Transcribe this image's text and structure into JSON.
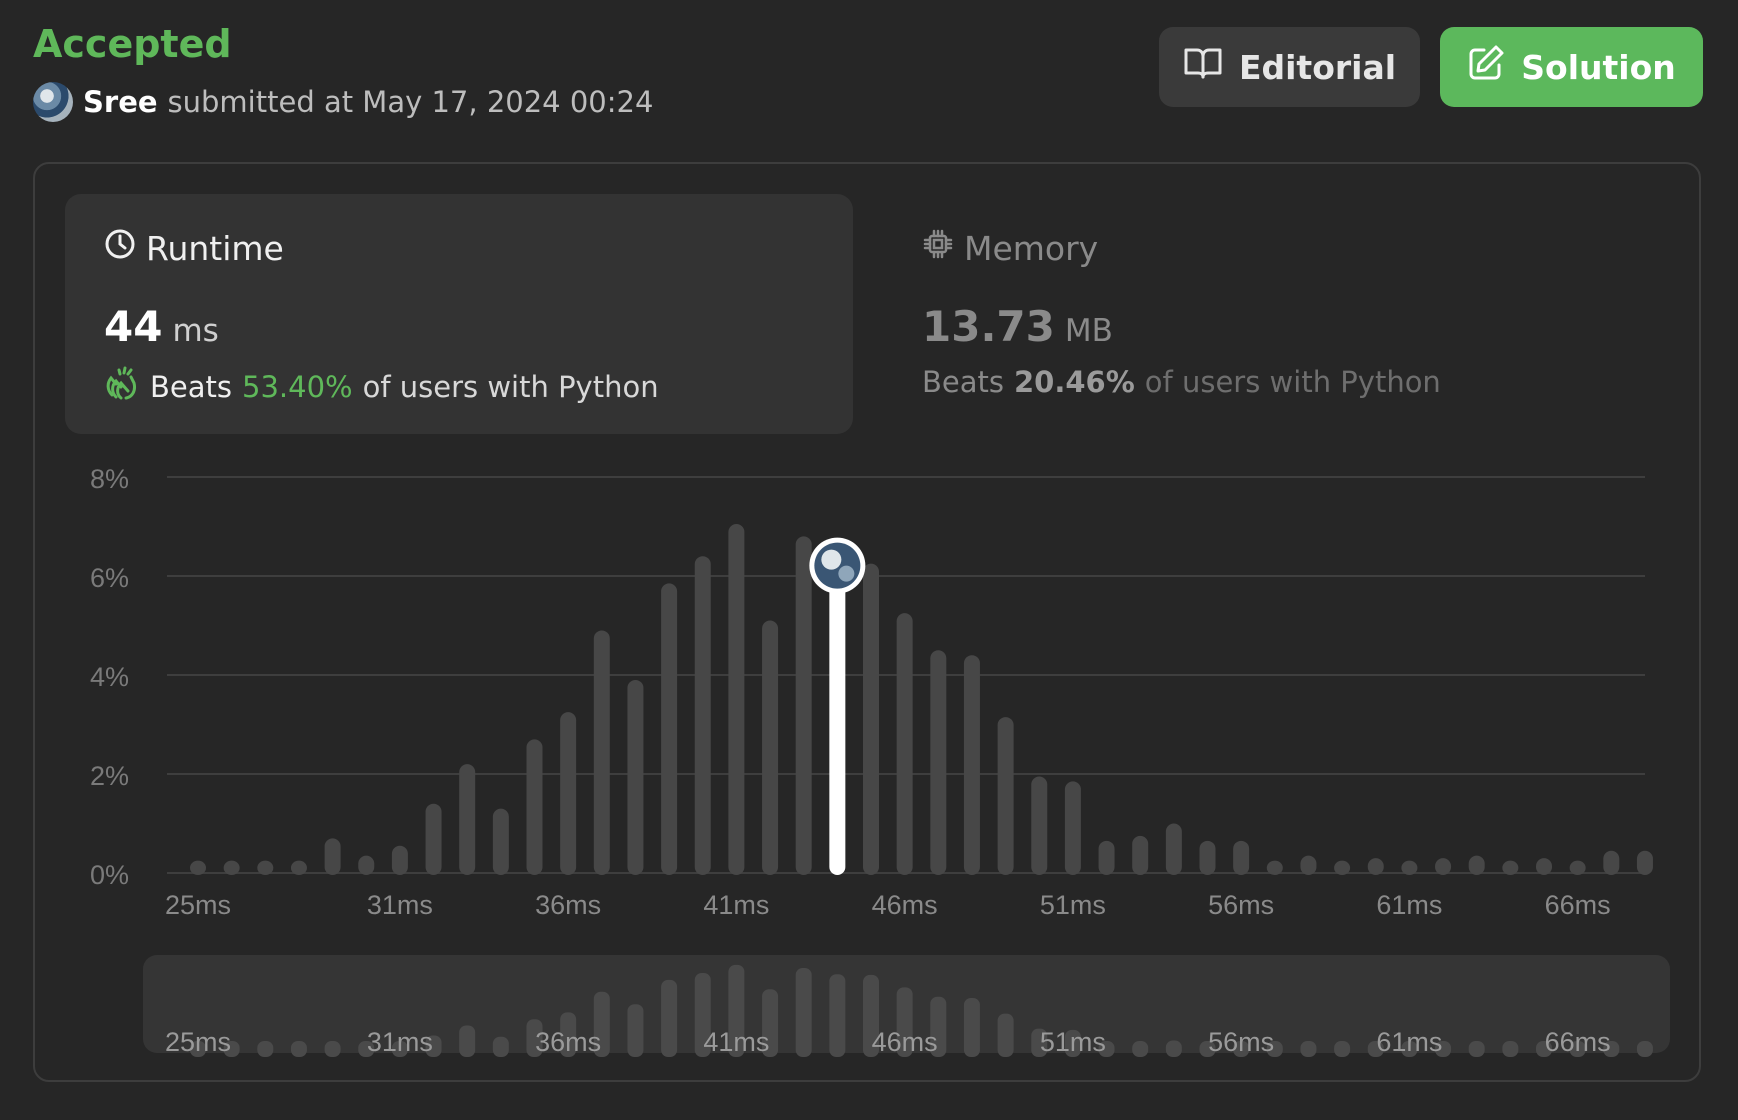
{
  "header": {
    "status": "Accepted",
    "username": "Sree",
    "submitted_text": "submitted at May 17, 2024 00:24",
    "editorial_label": "Editorial",
    "solution_label": "Solution"
  },
  "runtime": {
    "label": "Runtime",
    "value": "44",
    "unit": "ms",
    "beats_prefix": "Beats",
    "beats_pct": "53.40%",
    "beats_suffix": "of users with Python",
    "icon": "clock-icon",
    "beats_icon": "clapping-hands-icon"
  },
  "memory": {
    "label": "Memory",
    "value": "13.73",
    "unit": "MB",
    "beats_prefix": "Beats",
    "beats_pct": "20.46%",
    "beats_suffix": "of users with Python",
    "icon": "chip-icon"
  },
  "colors": {
    "accent_green": "#5cb85c",
    "bar": "#474747",
    "highlight_bar": "#ffffff"
  },
  "chart_data": {
    "type": "bar",
    "x": [
      25,
      26,
      27,
      28,
      29,
      30,
      31,
      32,
      33,
      34,
      35,
      36,
      37,
      38,
      39,
      40,
      41,
      42,
      43,
      44,
      45,
      46,
      47,
      48,
      49,
      50,
      51,
      52,
      53,
      54,
      55,
      56,
      57,
      58,
      59,
      60,
      61,
      62,
      63,
      64,
      65,
      66,
      67,
      68
    ],
    "values": [
      0.25,
      0.25,
      0.25,
      0.25,
      0.7,
      0.35,
      0.55,
      1.4,
      2.2,
      1.3,
      2.7,
      3.25,
      4.9,
      3.9,
      5.85,
      6.4,
      7.05,
      5.1,
      6.8,
      6.3,
      6.25,
      5.25,
      4.5,
      4.4,
      3.15,
      1.95,
      1.85,
      0.65,
      0.75,
      1.0,
      0.65,
      0.65,
      0.25,
      0.35,
      0.25,
      0.3,
      0.25,
      0.3,
      0.35,
      0.25,
      0.3,
      0.25,
      0.45,
      0.45
    ],
    "highlight_x": 44,
    "ylim": [
      0,
      8
    ],
    "y_ticks": [
      "8%",
      "6%",
      "4%",
      "2%",
      "0%"
    ],
    "x_tick_labels": [
      "25ms",
      "31ms",
      "36ms",
      "41ms",
      "46ms",
      "51ms",
      "56ms",
      "61ms",
      "66ms"
    ],
    "grid": true
  }
}
